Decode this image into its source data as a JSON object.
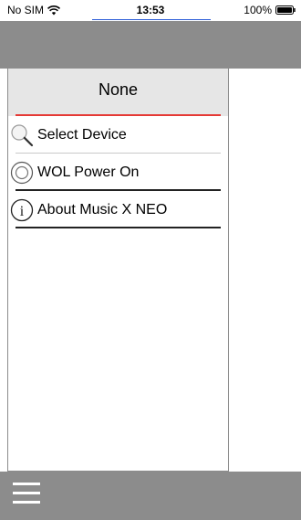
{
  "status_bar": {
    "carrier": "No SIM",
    "time": "13:53",
    "battery": "100%",
    "wifi_icon": "wifi-icon",
    "battery_icon": "battery-icon"
  },
  "side_menu": {
    "title": "None",
    "accent_color": "#e53935",
    "items": [
      {
        "label": "Select Device",
        "icon": "search-icon"
      },
      {
        "label": "WOL Power On",
        "icon": "power-circle-icon"
      },
      {
        "label": "About Music X NEO",
        "icon": "info-icon"
      }
    ]
  },
  "toolbar": {
    "menu_icon": "hamburger-menu-icon",
    "bar_color": "#8c8c8c"
  }
}
